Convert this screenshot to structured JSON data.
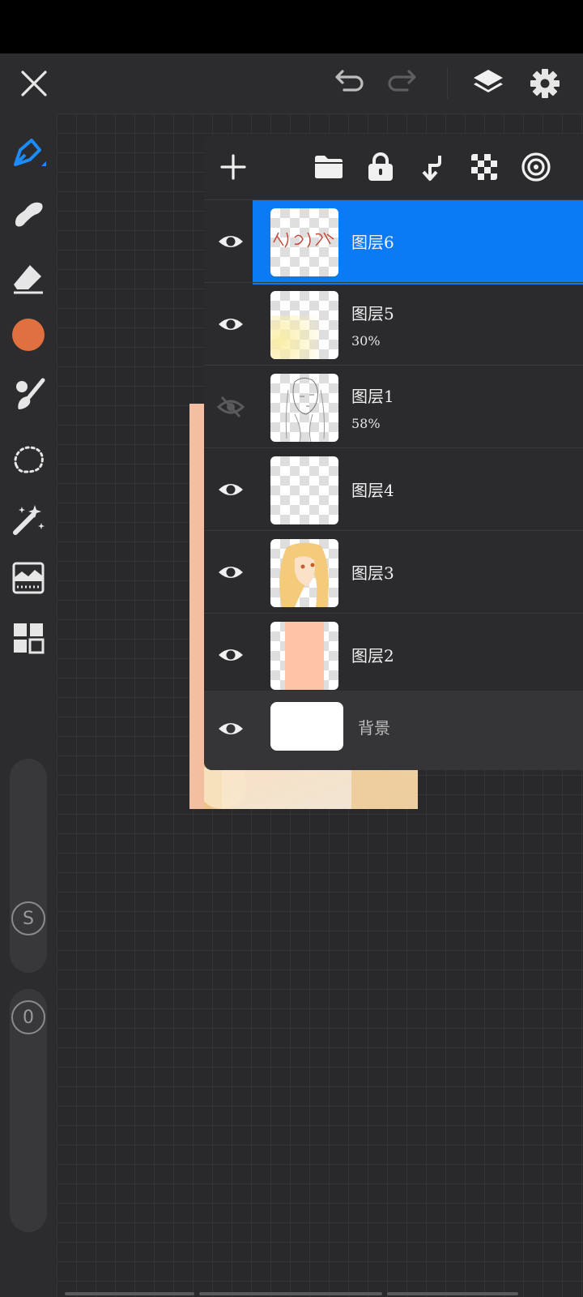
{
  "colors": {
    "accent": "#0a7bf5",
    "current_color": "#e07040",
    "layer2_fill": "#ffc4a8"
  },
  "top_bar": {
    "icons": [
      "close-icon",
      "undo-icon",
      "redo-icon",
      "layers-icon",
      "settings-icon"
    ]
  },
  "left_toolbar": {
    "tools": [
      "pen-icon",
      "smudge-icon",
      "eraser-icon",
      "color-icon",
      "brush-icon",
      "lasso-icon",
      "magic-wand-icon",
      "filter-icon",
      "gallery-icon"
    ],
    "size_badge": "S",
    "opacity_badge": "0"
  },
  "layers_panel": {
    "toolbar_icons": [
      "add-icon",
      "folder-icon",
      "lock-icon",
      "merge-down-icon",
      "checker-icon",
      "target-icon"
    ],
    "layers": [
      {
        "name": "图层6",
        "opacity": "",
        "visible": true,
        "active": true
      },
      {
        "name": "图层5",
        "opacity": "30%",
        "visible": true,
        "active": false
      },
      {
        "name": "图层1",
        "opacity": "58%",
        "visible": false,
        "active": false
      },
      {
        "name": "图层4",
        "opacity": "",
        "visible": true,
        "active": false
      },
      {
        "name": "图层3",
        "opacity": "",
        "visible": true,
        "active": false
      },
      {
        "name": "图层2",
        "opacity": "",
        "visible": true,
        "active": false
      }
    ],
    "background": {
      "name": "背景",
      "visible": true
    }
  }
}
